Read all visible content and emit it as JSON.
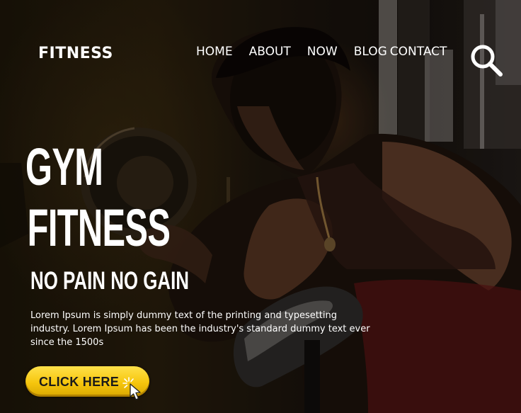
{
  "brand": {
    "logo": "FITNESS"
  },
  "nav": {
    "items": [
      {
        "label": "HOME"
      },
      {
        "label": "ABOUT"
      },
      {
        "label": "NOW"
      },
      {
        "label": "BLOG"
      },
      {
        "label": "CONTACT"
      }
    ]
  },
  "hero": {
    "headline_line1": "GYM",
    "headline_line2": "FITNESS",
    "subheadline": "NO PAIN NO GAIN",
    "body": "Lorem Ipsum is simply dummy text of the printing and typesetting industry. Lorem Ipsum has been the industry's standard dummy text ever since the 1500s",
    "cta_label": "CLICK HERE"
  },
  "icons": {
    "search": "search-icon",
    "cta_cursor": "click-cursor-icon"
  },
  "colors": {
    "text": "#ffffff",
    "cta_yellow": "#f6c60d",
    "cta_text": "#1a1a1a"
  }
}
